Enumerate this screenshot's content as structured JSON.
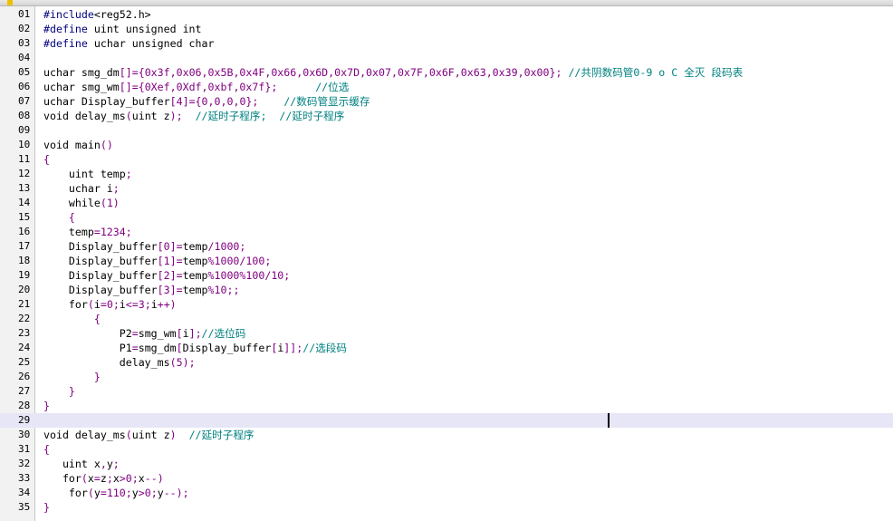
{
  "colors": {
    "comment": "#008080",
    "string": "#800080",
    "keyword": "#000080",
    "text": "#000000",
    "current_line": "#e6e6f6"
  },
  "current_line": 29,
  "lines": [
    {
      "n": "01",
      "code": "#include<reg52.h>"
    },
    {
      "n": "02",
      "code": "#define uint unsigned int"
    },
    {
      "n": "03",
      "code": "#define uchar unsigned char"
    },
    {
      "n": "04",
      "code": ""
    },
    {
      "n": "05",
      "code": "uchar smg_dm[]={0x3f,0x06,0x5B,0x4F,0x66,0x6D,0x7D,0x07,0x7F,0x6F,0x63,0x39,0x00}; //共阴数码管0-9 o C 全灭 段码表"
    },
    {
      "n": "06",
      "code": "uchar smg_wm[]={0Xef,0Xdf,0xbf,0x7f};      //位选"
    },
    {
      "n": "07",
      "code": "uchar Display_buffer[4]={0,0,0,0};    //数码管显示缓存"
    },
    {
      "n": "08",
      "code": "void delay_ms(uint z);  //延时子程序;  //延时子程序"
    },
    {
      "n": "09",
      "code": ""
    },
    {
      "n": "10",
      "code": "void main()"
    },
    {
      "n": "11",
      "code": "{"
    },
    {
      "n": "12",
      "code": "    uint temp;"
    },
    {
      "n": "13",
      "code": "    uchar i;"
    },
    {
      "n": "14",
      "code": "    while(1)"
    },
    {
      "n": "15",
      "code": "    {"
    },
    {
      "n": "16",
      "code": "    temp=1234;"
    },
    {
      "n": "17",
      "code": "    Display_buffer[0]=temp/1000;"
    },
    {
      "n": "18",
      "code": "    Display_buffer[1]=temp%1000/100;"
    },
    {
      "n": "19",
      "code": "    Display_buffer[2]=temp%1000%100/10;"
    },
    {
      "n": "20",
      "code": "    Display_buffer[3]=temp%10;;"
    },
    {
      "n": "21",
      "code": "    for(i=0;i<=3;i++)"
    },
    {
      "n": "22",
      "code": "        {"
    },
    {
      "n": "23",
      "code": "            P2=smg_wm[i];//选位码"
    },
    {
      "n": "24",
      "code": "            P1=smg_dm[Display_buffer[i]];//选段码"
    },
    {
      "n": "25",
      "code": "            delay_ms(5);"
    },
    {
      "n": "26",
      "code": "        }"
    },
    {
      "n": "27",
      "code": "    }"
    },
    {
      "n": "28",
      "code": "}"
    },
    {
      "n": "29",
      "code": ""
    },
    {
      "n": "30",
      "code": "void delay_ms(uint z)  //延时子程序"
    },
    {
      "n": "31",
      "code": "{"
    },
    {
      "n": "32",
      "code": "   uint x,y;"
    },
    {
      "n": "33",
      "code": "   for(x=z;x>0;x--)"
    },
    {
      "n": "34",
      "code": "    for(y=110;y>0;y--);"
    },
    {
      "n": "35",
      "code": "}"
    }
  ]
}
